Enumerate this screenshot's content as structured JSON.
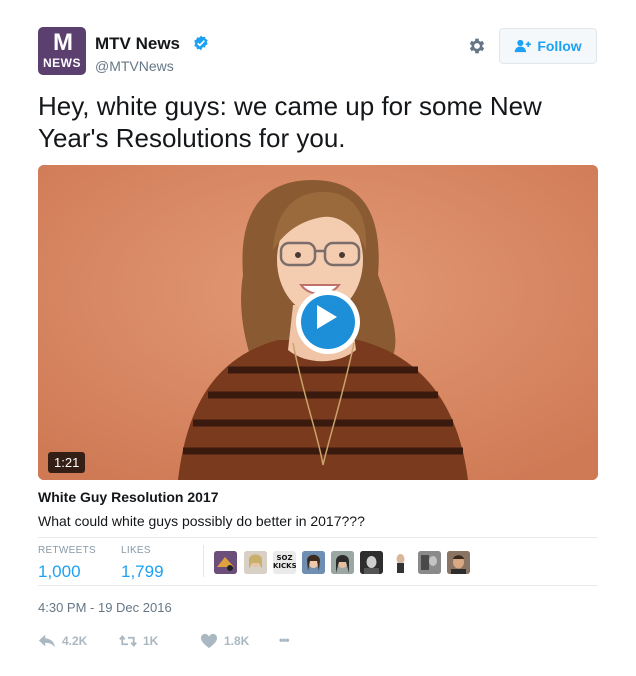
{
  "account": {
    "avatar_text_top": "M",
    "avatar_text_bottom": "NEWS",
    "name": "MTV News",
    "handle": "@MTVNews",
    "verified": true
  },
  "header": {
    "gear_icon": "gear-icon",
    "follow_label": "Follow"
  },
  "tweet": {
    "text": "Hey, white guys: we came up for some New Year's Resolutions for you."
  },
  "media": {
    "duration": "1:21",
    "play_icon": "play-icon",
    "card_title": "White Guy Resolution 2017",
    "card_description": "What could white guys possibly do better in 2017???"
  },
  "stats": {
    "retweets_label": "RETWEETS",
    "retweets_value": "1,000",
    "likes_label": "LIKES",
    "likes_value": "1,799",
    "likers": [
      {
        "name": "liker-1",
        "color": "#6b4f7a"
      },
      {
        "name": "liker-2",
        "color": "#c9b7a6"
      },
      {
        "name": "liker-3",
        "color": "#eaeaea",
        "text": "SOZ KICKS"
      },
      {
        "name": "liker-4",
        "color": "#6f8fb2"
      },
      {
        "name": "liker-5",
        "color": "#5c6b6a"
      },
      {
        "name": "liker-6",
        "color": "#3b3b3b"
      },
      {
        "name": "liker-7",
        "color": "#d6c7b8"
      },
      {
        "name": "liker-8",
        "color": "#7a7a7a"
      },
      {
        "name": "liker-9",
        "color": "#5a4636"
      }
    ]
  },
  "timestamp": "4:30 PM - 19 Dec 2016",
  "actions": {
    "reply_count": "4.2K",
    "retweet_count": "1K",
    "like_count": "1.8K",
    "more_label": "•••"
  },
  "colors": {
    "accent": "#1da1f2",
    "play_blue": "#1d8fd8",
    "secondary_text": "#657786"
  }
}
